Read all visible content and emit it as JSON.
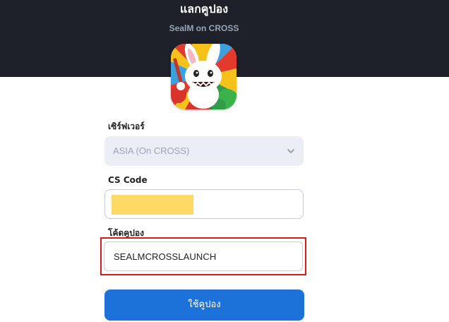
{
  "header": {
    "title": "แลกคูปอง",
    "subtitle": "SealM on CROSS",
    "background_color": "#1e2129"
  },
  "app_icon": {
    "name": "sealm-app-icon"
  },
  "form": {
    "server": {
      "label": "เซิร์ฟเวอร์",
      "selected_value": "ASIA (On CROSS)"
    },
    "cs_code": {
      "label": "CS Code",
      "value_redacted": true,
      "redaction_color": "#ffd966"
    },
    "coupon": {
      "label": "โค้ดคูปอง",
      "value": "SEALMCROSSLAUNCH",
      "highlight_color": "#d41a1a"
    },
    "submit": {
      "label": "ใช้คูปอง",
      "color": "#1d72d9"
    }
  }
}
